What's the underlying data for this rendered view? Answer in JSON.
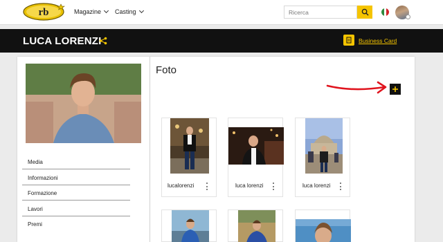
{
  "navbar": {
    "logo_text": "rb",
    "menu": [
      {
        "label": "Magazine"
      },
      {
        "label": "Casting"
      }
    ],
    "search": {
      "placeholder": "Ricerca",
      "value": ""
    },
    "flag": "italy-flag-icon"
  },
  "profile": {
    "name": "LUCA LORENZI",
    "business_card_label": "Business Card"
  },
  "sidebar": {
    "items": [
      {
        "label": "Media"
      },
      {
        "label": "Informazioni"
      },
      {
        "label": "Formazione"
      },
      {
        "label": "Lavori"
      },
      {
        "label": "Premi"
      }
    ]
  },
  "main": {
    "title": "Foto",
    "photos": [
      {
        "caption": "lucalorenzi"
      },
      {
        "caption": "luca lorenzi"
      },
      {
        "caption": "luca lorenzi"
      }
    ]
  },
  "colors": {
    "accent": "#f5c400",
    "header_bg": "#111111",
    "arrow": "#e0141e"
  }
}
